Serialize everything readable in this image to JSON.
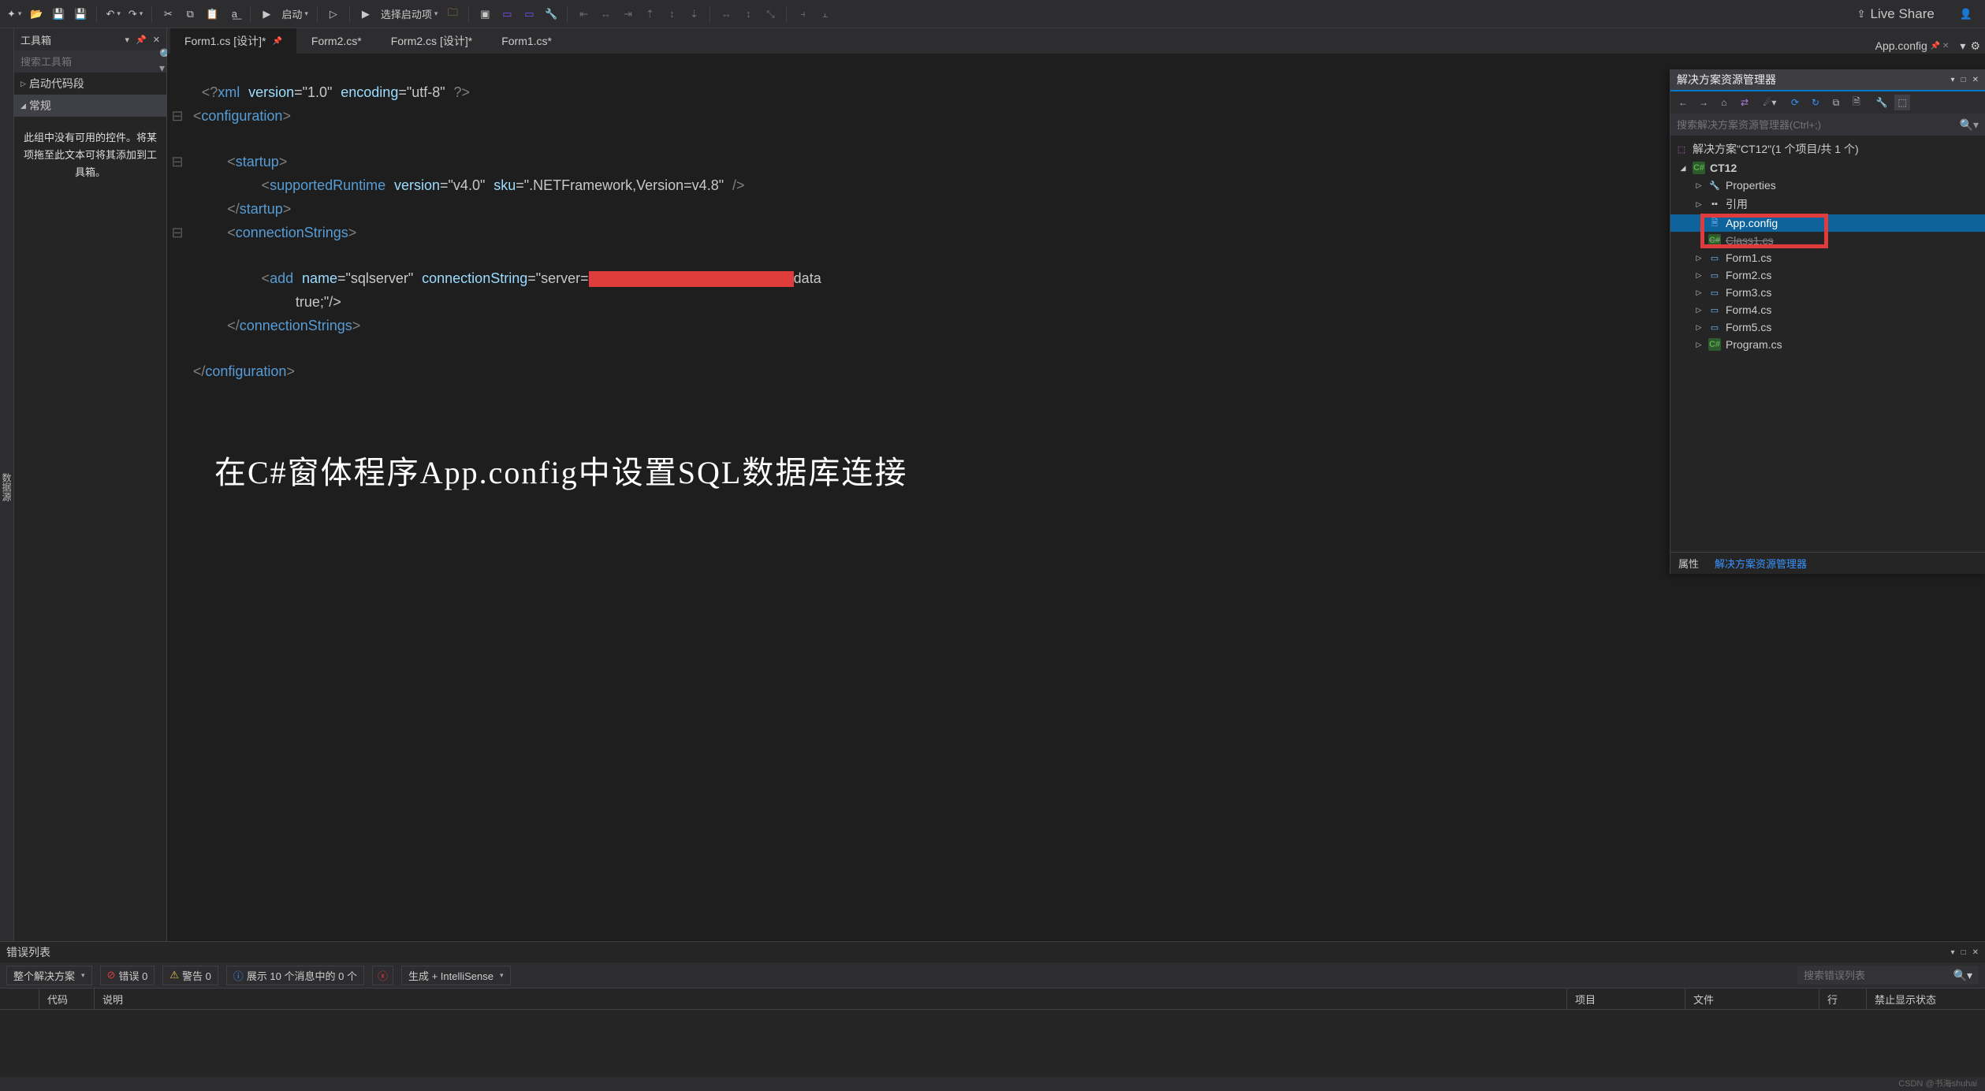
{
  "toolbar": {
    "launch": "启动",
    "launch_project_placeholder": "选择启动项",
    "liveshare": "Live Share"
  },
  "toolbox": {
    "title": "工具箱",
    "search_placeholder": "搜索工具箱",
    "group1": "启动代码段",
    "group2": "常规",
    "empty": "此组中没有可用的控件。将某项拖至此文本可将其添加到工具箱。"
  },
  "tabs": {
    "t1": "Form1.cs [设计]*",
    "t2": "Form2.cs*",
    "t3": "Form2.cs [设计]*",
    "t4": "Form1.cs*",
    "current": "App.config"
  },
  "code": {
    "l1a": "<?",
    "l1b": "xml",
    "l1c": "version",
    "l1d": "=\"1.0\"",
    "l1e": "encoding",
    "l1f": "=\"utf-8\"",
    "l1g": "?>",
    "l2": "configuration",
    "l3": "startup",
    "l4t": "supportedRuntime",
    "l4a1": "version",
    "l4v1": "=\"v4.0\"",
    "l4a2": "sku",
    "l4v2": "=\".NETFramework,Version=v4.8\"",
    "l5": "startup",
    "l6": "connectionStrings",
    "l7t": "add",
    "l7a1": "name",
    "l7v1": "=\"sqlserver\"",
    "l7a2": "connectionString",
    "l7v2a": "=\"server=",
    "l7v2b": "data",
    "l7v3": "true;\"/>",
    "l8": "connectionStrings",
    "l9": "configuration",
    "overlay": "在C#窗体程序App.config中设置SQL数据库连接"
  },
  "solution": {
    "title": "解决方案资源管理器",
    "search_placeholder": "搜索解决方案资源管理器(Ctrl+;)",
    "root": "解决方案\"CT12\"(1 个项目/共 1 个)",
    "proj": "CT12",
    "n_props": "Properties",
    "n_refs": "引用",
    "n_app": "App.config",
    "n_class1": "Class1.cs",
    "n_f1": "Form1.cs",
    "n_f2": "Form2.cs",
    "n_f3": "Form3.cs",
    "n_f4": "Form4.cs",
    "n_f5": "Form5.cs",
    "n_prog": "Program.cs",
    "tab_props": "属性",
    "tab_sol": "解决方案资源管理器"
  },
  "errors": {
    "title": "错误列表",
    "scope": "整个解决方案",
    "err": "错误 0",
    "warn": "警告 0",
    "info": "展示 10 个消息中的 0 个",
    "build": "生成 + IntelliSense",
    "search_placeholder": "搜索错误列表",
    "col_code": "代码",
    "col_desc": "说明",
    "col_proj": "项目",
    "col_file": "文件",
    "col_line": "行",
    "col_suppress": "禁止显示状态"
  },
  "watermark": "CSDN @书海shuhai"
}
